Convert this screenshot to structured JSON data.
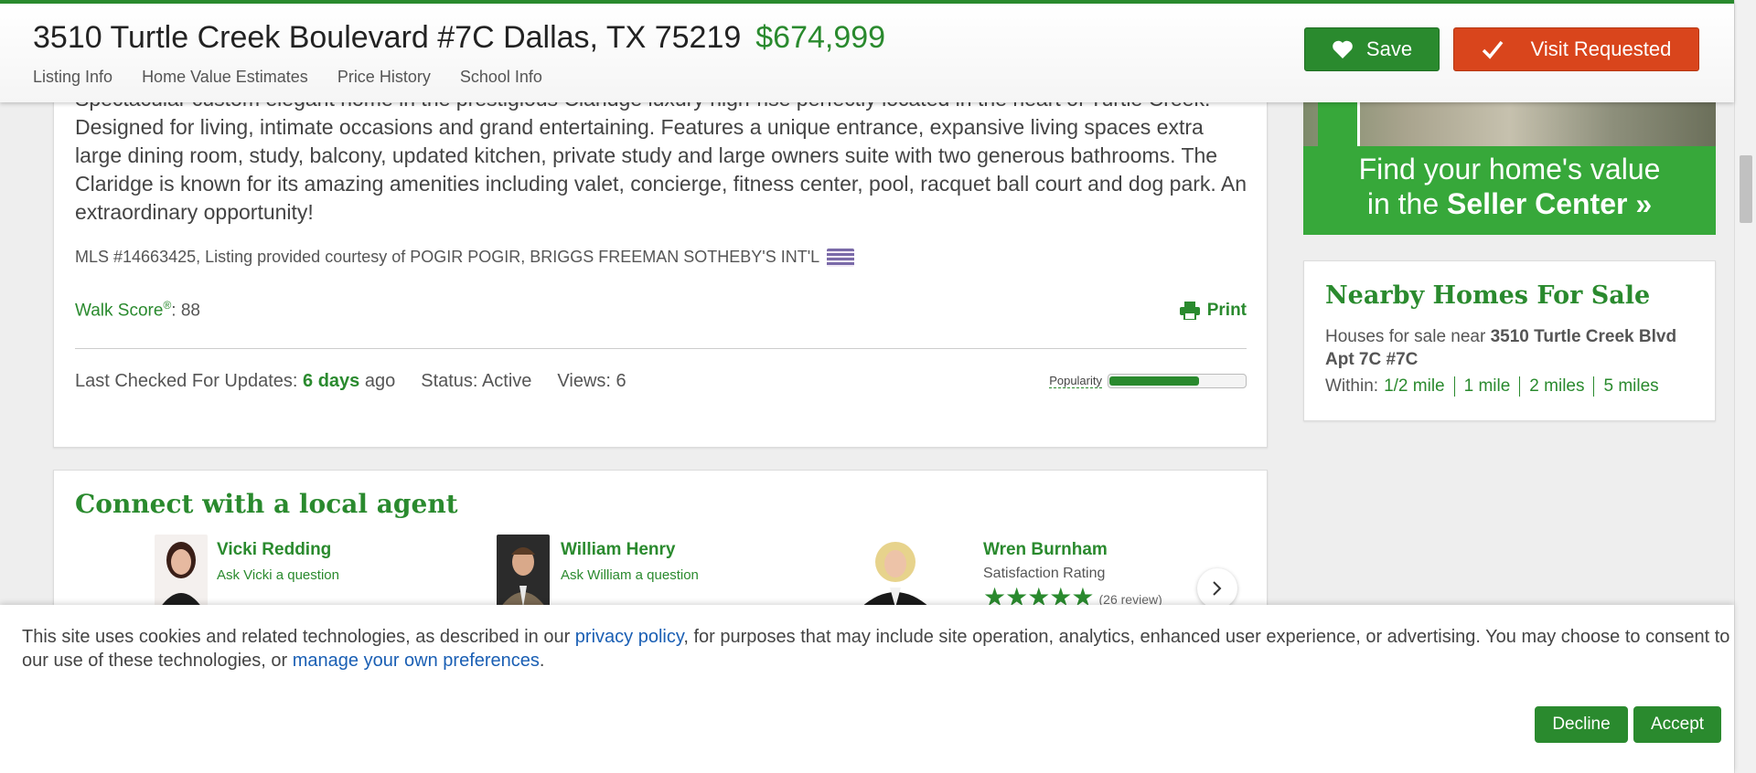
{
  "header": {
    "address": "3510 Turtle Creek Boulevard #7C Dallas, TX 75219",
    "price": "$674,999",
    "tabs": [
      "Listing Info",
      "Home Value Estimates",
      "Price History",
      "School Info"
    ],
    "save_label": "Save",
    "visit_label": "Visit Requested"
  },
  "listing": {
    "description": "Spectacular custom elegant home in the prestigious Claridge luxury high-rise perfectly located in the heart of Turtle Creek. Designed for living, intimate occasions and grand entertaining. Features a unique entrance, expansive living spaces extra large dining room, study, balcony, updated kitchen, private study and large owners suite with two generous bathrooms. The Claridge is known for its amazing amenities including valet, concierge, fitness center, pool, racquet ball court and dog park. An extraordinary opportunity!",
    "mls": "MLS #14663425, Listing provided courtesy of POGIR POGIR, BRIGGS FREEMAN SOTHEBY'S INT'L",
    "walk_score_label": "Walk Score",
    "walk_score_reg": "®",
    "walk_score_value": ": 88",
    "print_label": "Print",
    "last_checked_label": "Last Checked For Updates:",
    "last_checked_value": "6 days",
    "last_checked_suffix": "ago",
    "status": "Status: Active",
    "views": "Views: 6",
    "popularity_label": "Popularity",
    "popularity": 0.65
  },
  "agents": {
    "title": "Connect with a local agent",
    "items": [
      {
        "name": "Vicki Redding",
        "sub": "Ask Vicki a question"
      },
      {
        "name": "William Henry",
        "sub": "Ask William a question"
      },
      {
        "name": "Wren Burnham",
        "sub": "Satisfaction Rating",
        "stars": "★★★★★",
        "rating": 5,
        "reviews": "(26 review)"
      }
    ]
  },
  "seller_center": {
    "line1": "Find your home's value",
    "line2_prefix": "in the",
    "line2_bold": "Seller Center »"
  },
  "nearby": {
    "title": "Nearby Homes For Sale",
    "text_prefix": "Houses for sale near",
    "text_bold": "3510 Turtle Creek Blvd Apt 7C #7C",
    "within_label": "Within:",
    "ranges": [
      "1/2 mile",
      "1 mile",
      "2 miles",
      "5 miles"
    ]
  },
  "cookie": {
    "text1": "This site uses cookies and related technologies, as described in our",
    "privacy_link": "privacy policy",
    "text2": ", for purposes that may include site operation, analytics, enhanced user experience, or advertising. You may choose to consent to our use of these technologies, or",
    "prefs_link": "manage your own preferences",
    "text3": ".",
    "decline_label": "Decline",
    "accept_label": "Accept"
  },
  "colors": {
    "brand_green": "#2a8a2e",
    "visit_orange": "#d9451c",
    "link_blue": "#1a5fb4"
  }
}
